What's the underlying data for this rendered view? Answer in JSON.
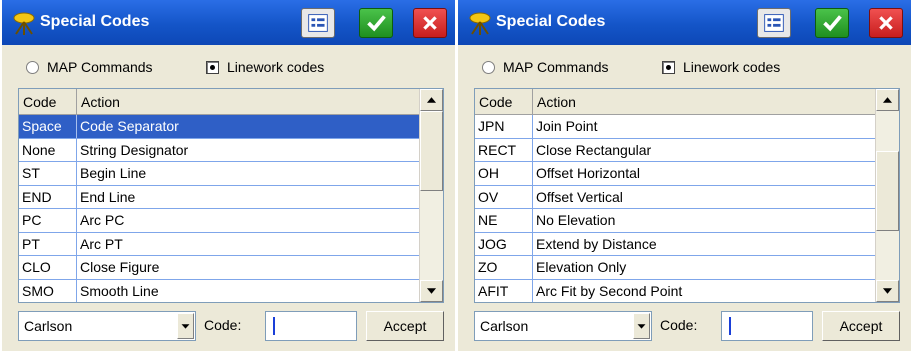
{
  "colors": {
    "titlebar": "#1455c8",
    "selection": "#2f5fc6",
    "ok_button": "#1f8f1f",
    "close_button": "#c81e1e",
    "window_bg": "#ece9d8"
  },
  "icons": {
    "app": "surveyor-tripod-icon",
    "list": "list-view-icon",
    "ok": "checkmark-icon",
    "close": "x-close-icon",
    "scroll_up": "scroll-up-arrow-icon",
    "scroll_down": "scroll-down-arrow-icon",
    "dropdown": "dropdown-arrow-icon"
  },
  "left": {
    "title": "Special Codes",
    "radio_map": "MAP Commands",
    "radio_linework": "Linework codes",
    "radio_selected": "linework",
    "headers": {
      "code": "Code",
      "action": "Action"
    },
    "rows": [
      {
        "code": "Space",
        "action": "Code Separator",
        "selected": true
      },
      {
        "code": "None",
        "action": "String Designator"
      },
      {
        "code": "ST",
        "action": "Begin Line"
      },
      {
        "code": "END",
        "action": "End Line"
      },
      {
        "code": "PC",
        "action": "Arc PC"
      },
      {
        "code": "PT",
        "action": "Arc PT"
      },
      {
        "code": "CLO",
        "action": "Close Figure"
      },
      {
        "code": "SMO",
        "action": "Smooth Line"
      }
    ],
    "scroll_position": 0,
    "combo_value": "Carlson",
    "code_label": "Code:",
    "code_value": "",
    "accept_label": "Accept"
  },
  "right": {
    "title": "Special Codes",
    "radio_map": "MAP Commands",
    "radio_linework": "Linework codes",
    "radio_selected": "linework",
    "headers": {
      "code": "Code",
      "action": "Action"
    },
    "rows": [
      {
        "code": "JPN",
        "action": "Join Point"
      },
      {
        "code": "RECT",
        "action": "Close Rectangular"
      },
      {
        "code": "OH",
        "action": "Offset Horizontal"
      },
      {
        "code": "OV",
        "action": "Offset Vertical"
      },
      {
        "code": "NE",
        "action": "No Elevation"
      },
      {
        "code": "JOG",
        "action": "Extend by Distance"
      },
      {
        "code": "ZO",
        "action": "Elevation Only"
      },
      {
        "code": "AFIT",
        "action": "Arc Fit by Second Point"
      }
    ],
    "scroll_position": 0.45,
    "combo_value": "Carlson",
    "code_label": "Code:",
    "code_value": "",
    "accept_label": "Accept"
  }
}
